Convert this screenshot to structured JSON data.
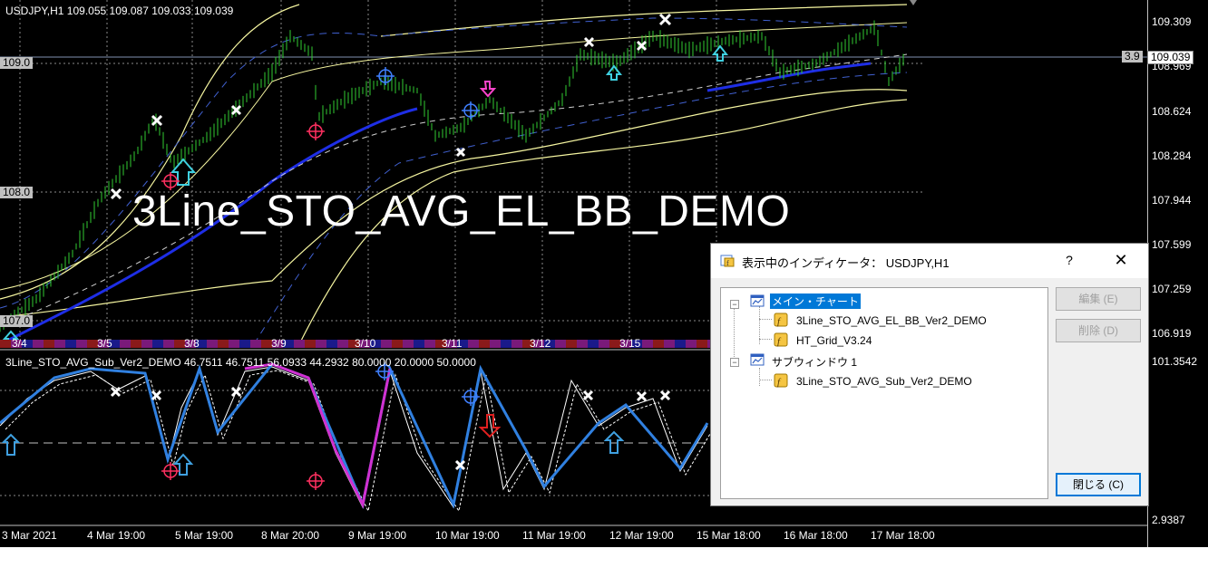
{
  "main_chart": {
    "header": "USDJPY,H1  109.055 109.087 109.033 109.039",
    "watermark": "3Line_STO_AVG_EL_BB_DEMO",
    "price_axis": [
      "109.309",
      "108.969",
      "108.624",
      "108.284",
      "107.944",
      "107.599",
      "107.259",
      "106.919"
    ],
    "level_labels": [
      "109.0",
      "108.0",
      "107.0"
    ],
    "current_price": "109.039",
    "spread_label": "3.9",
    "day_labels": [
      "3/4",
      "3/5",
      "3/8",
      "3/9",
      "3/10",
      "3/11",
      "3/12",
      "3/15"
    ]
  },
  "sub_chart": {
    "header": "3Line_STO_AVG_Sub_Ver2_DEMO 46.7511 46.7511 56.0933 44.2932 80.0000 20.0000 50.0000",
    "axis_max": "101.3542",
    "axis_min": "2.9387"
  },
  "time_axis": [
    "3 Mar 2021",
    "4 Mar 19:00",
    "5 Mar 19:00",
    "8 Mar 20:00",
    "9 Mar 19:00",
    "10 Mar 19:00",
    "11 Mar 19:00",
    "12 Mar 19:00",
    "15 Mar 18:00",
    "16 Mar 18:00",
    "17 Mar 18:00"
  ],
  "dialog": {
    "title": "表示中のインディケータ： USDJPY,H1",
    "help": "?",
    "close": "✕",
    "tree": {
      "main_window": "メイン・チャート",
      "main_items": [
        "3Line_STO_AVG_EL_BB_Ver2_DEMO",
        "HT_Grid_V3.24"
      ],
      "sub_window": "サブウィンドウ 1",
      "sub_items": [
        "3Line_STO_AVG_Sub_Ver2_DEMO"
      ]
    },
    "buttons": {
      "edit": "編集 (E)",
      "delete": "削除 (D)",
      "close": "閉じる (C)"
    }
  },
  "colors": {
    "candle": "#32cd32",
    "ma_main": "#1e2ee6",
    "bands_outer": "#f5f5a0",
    "bands_inner": "#5080e0",
    "arrow_up": "#3fd0e0",
    "arrow_down": "#ff44cc",
    "cross": "#ffffff",
    "sto_pink": "#d030d0",
    "sto_blue": "#3080e0"
  },
  "icons": {
    "dialog": "indicator-list-icon",
    "window": "chart-window-icon",
    "indicator": "function-icon"
  }
}
